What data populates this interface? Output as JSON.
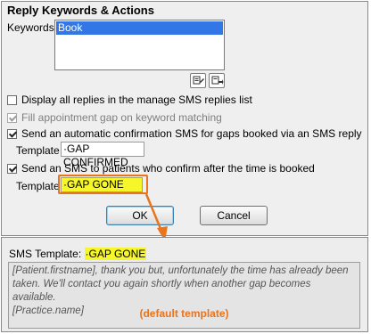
{
  "dialog": {
    "title": "Reply Keywords & Actions",
    "keywords_label": "Keywords",
    "keywords": [
      "Book"
    ],
    "options": [
      {
        "label": "Display all replies in the manage SMS replies list",
        "checked": false,
        "disabled": false
      },
      {
        "label": "Fill appointment gap on keyword matching",
        "checked": true,
        "disabled": true
      },
      {
        "label": "Send an automatic confirmation SMS for gaps booked via an SMS reply",
        "checked": true,
        "disabled": false
      },
      {
        "label": "Send an SMS to patients who confirm after the time is booked",
        "checked": true,
        "disabled": false
      }
    ],
    "template_label": "Template",
    "template_confirmed": "·GAP CONFIRMED",
    "template_gone": "·GAP GONE",
    "ok_label": "OK",
    "cancel_label": "Cancel"
  },
  "preview": {
    "label": "SMS Template:",
    "template_name": "·GAP GONE",
    "body_line1": "[Patient.firstname], thank you but, unfortunately the time has already been",
    "body_line2": "taken. We'll contact you again shortly when another gap becomes available.",
    "body_line3": "[Practice.name]",
    "annotation": "(default template)"
  },
  "colors": {
    "highlight": "#f6f62a",
    "callout": "#e8741d",
    "selection": "#3377e6"
  },
  "icons": [
    "edit-keyword-icon",
    "delete-keyword-icon",
    "arrow-icon"
  ]
}
